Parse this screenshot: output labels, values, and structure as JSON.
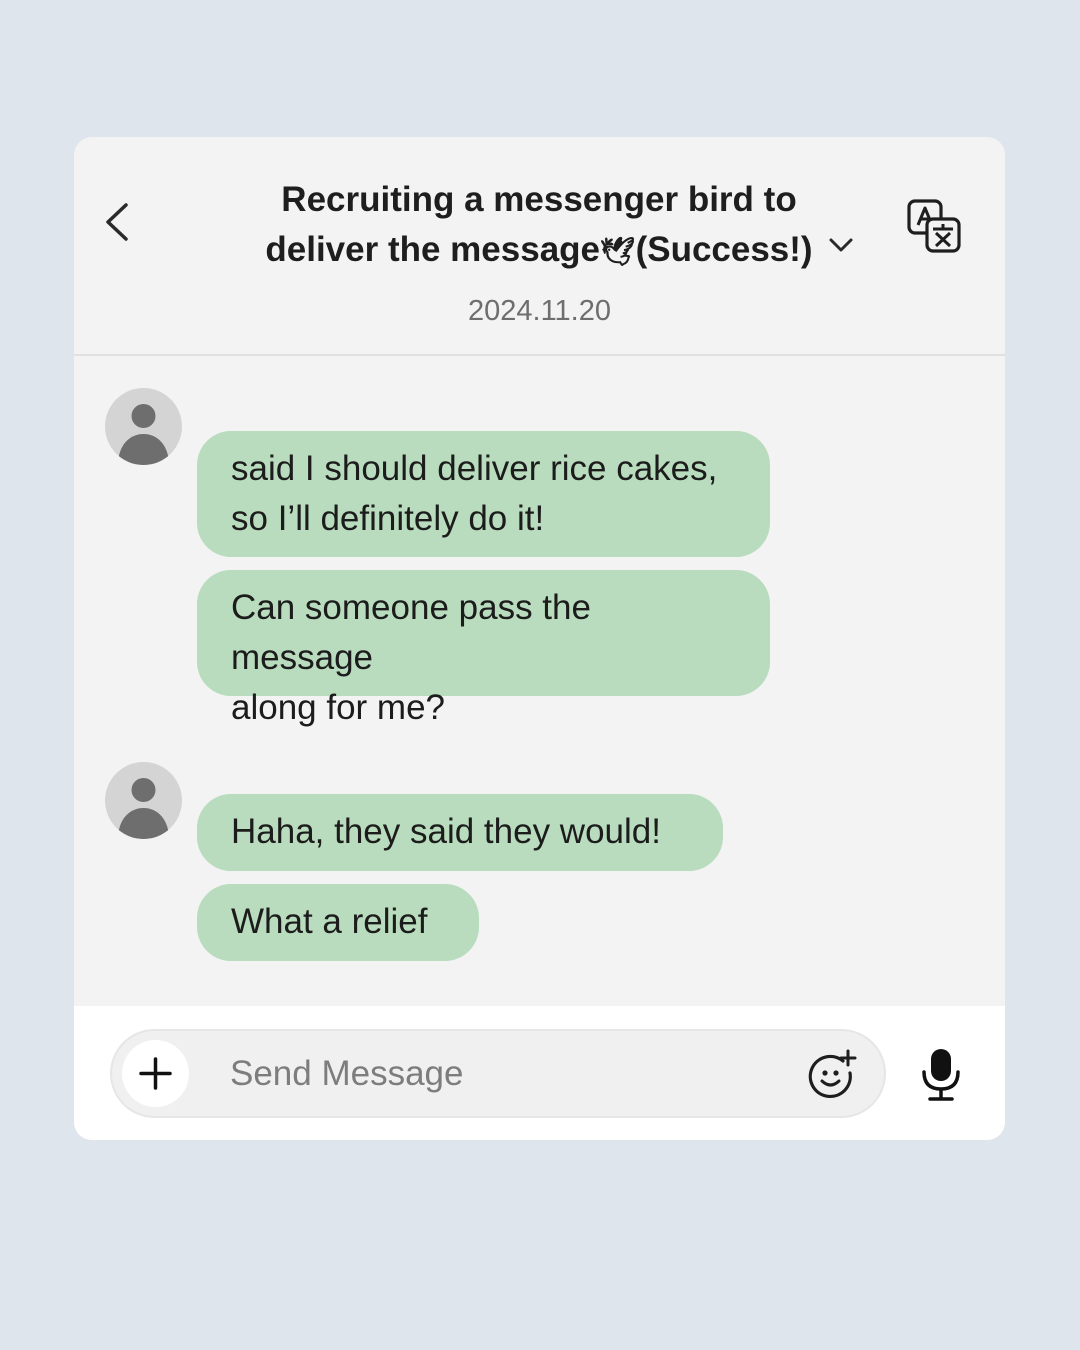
{
  "header": {
    "title_line1": "Recruiting a messenger bird to",
    "title_line2": "deliver the message",
    "title_emoji": "🕊",
    "title_suffix": "(Success!)",
    "date": "2024.11.20"
  },
  "messages": [
    {
      "text_line1": "said I should deliver rice cakes,",
      "text_line2": "so I’ll definitely do it!"
    },
    {
      "text_line1": "Can someone pass the message",
      "text_line2": "along for me?"
    },
    {
      "text_line1": "Haha, they said they would!"
    },
    {
      "text_line1": "What a relief"
    }
  ],
  "composer": {
    "placeholder": "Send Message"
  },
  "icons": {
    "back": "chevron-left-icon",
    "dropdown": "chevron-down-icon",
    "translate": "translate-icon",
    "avatar": "person-icon",
    "plus": "plus-icon",
    "emoji": "emoji-add-icon",
    "mic": "microphone-icon"
  },
  "colors": {
    "background": "#dfe5ec",
    "card": "#f3f3f3",
    "bubble": "#b8dcbd",
    "avatar_bg": "#d4d4d4",
    "avatar_fg": "#6e6e6e"
  }
}
